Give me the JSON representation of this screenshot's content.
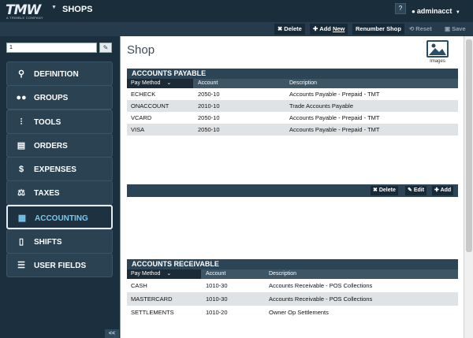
{
  "app": {
    "logo_text": "TMW",
    "logo_sub": "A TRIMBLE COMPANY",
    "title": "SHOPS",
    "help": "?",
    "user": "adminacct"
  },
  "toolbar": {
    "delete": "Delete",
    "add_new_prefix": "Add ",
    "add_new_underlined": "New",
    "renumber": "Renumber Shop",
    "reset": "Reset",
    "save": "Save"
  },
  "sidebar": {
    "search_value": "1",
    "items": [
      {
        "label": "DEFINITION",
        "icon": "search-icon"
      },
      {
        "label": "GROUPS",
        "icon": "groups-icon"
      },
      {
        "label": "TOOLS",
        "icon": "tools-icon"
      },
      {
        "label": "ORDERS",
        "icon": "document-icon"
      },
      {
        "label": "EXPENSES",
        "icon": "dollar-icon"
      },
      {
        "label": "TAXES",
        "icon": "scale-icon"
      },
      {
        "label": "ACCOUNTING",
        "icon": "ledger-icon",
        "active": true
      },
      {
        "label": "SHIFTS",
        "icon": "badge-icon"
      },
      {
        "label": "USER FIELDS",
        "icon": "list-icon"
      }
    ],
    "collapse": "<<"
  },
  "main": {
    "title": "Shop",
    "images_label": "Images"
  },
  "accounts_payable": {
    "title": "ACCOUNTS PAYABLE",
    "columns": [
      "Pay Method",
      "Account",
      "Description"
    ],
    "sort_arrow": "⌄",
    "rows": [
      [
        "ECHECK",
        "2050-10",
        "Accounts Payable - Prepaid - TMT"
      ],
      [
        "ONACCOUNT",
        "2010-10",
        "Trade Accounts Payable"
      ],
      [
        "VCARD",
        "2050-10",
        "Accounts Payable - Prepaid - TMT"
      ],
      [
        "VISA",
        "2050-10",
        "Accounts Payable - Prepaid - TMT"
      ]
    ],
    "actions": {
      "delete": "Delete",
      "edit": "Edit",
      "add": "Add"
    }
  },
  "accounts_receivable": {
    "title": "ACCOUNTS RECEIVABLE",
    "columns": [
      "Pay Method",
      "Account",
      "Description"
    ],
    "sort_arrow": "⌄",
    "rows": [
      [
        "CASH",
        "1010-30",
        "Accounts Receivable - POS Collections"
      ],
      [
        "MASTERCARD",
        "1010-30",
        "Accounts Receivable - POS Collections"
      ],
      [
        "SETTLEMENTS",
        "1010-20",
        "Owner Op Settlements"
      ]
    ]
  },
  "colors": {
    "topbar": "#1a2d3b",
    "sidebar": "#1c2f3e",
    "nav_item": "#2b4253",
    "active_text": "#78c8ef",
    "section_header": "#2b4557",
    "row_alt": "#dfe3e6"
  }
}
